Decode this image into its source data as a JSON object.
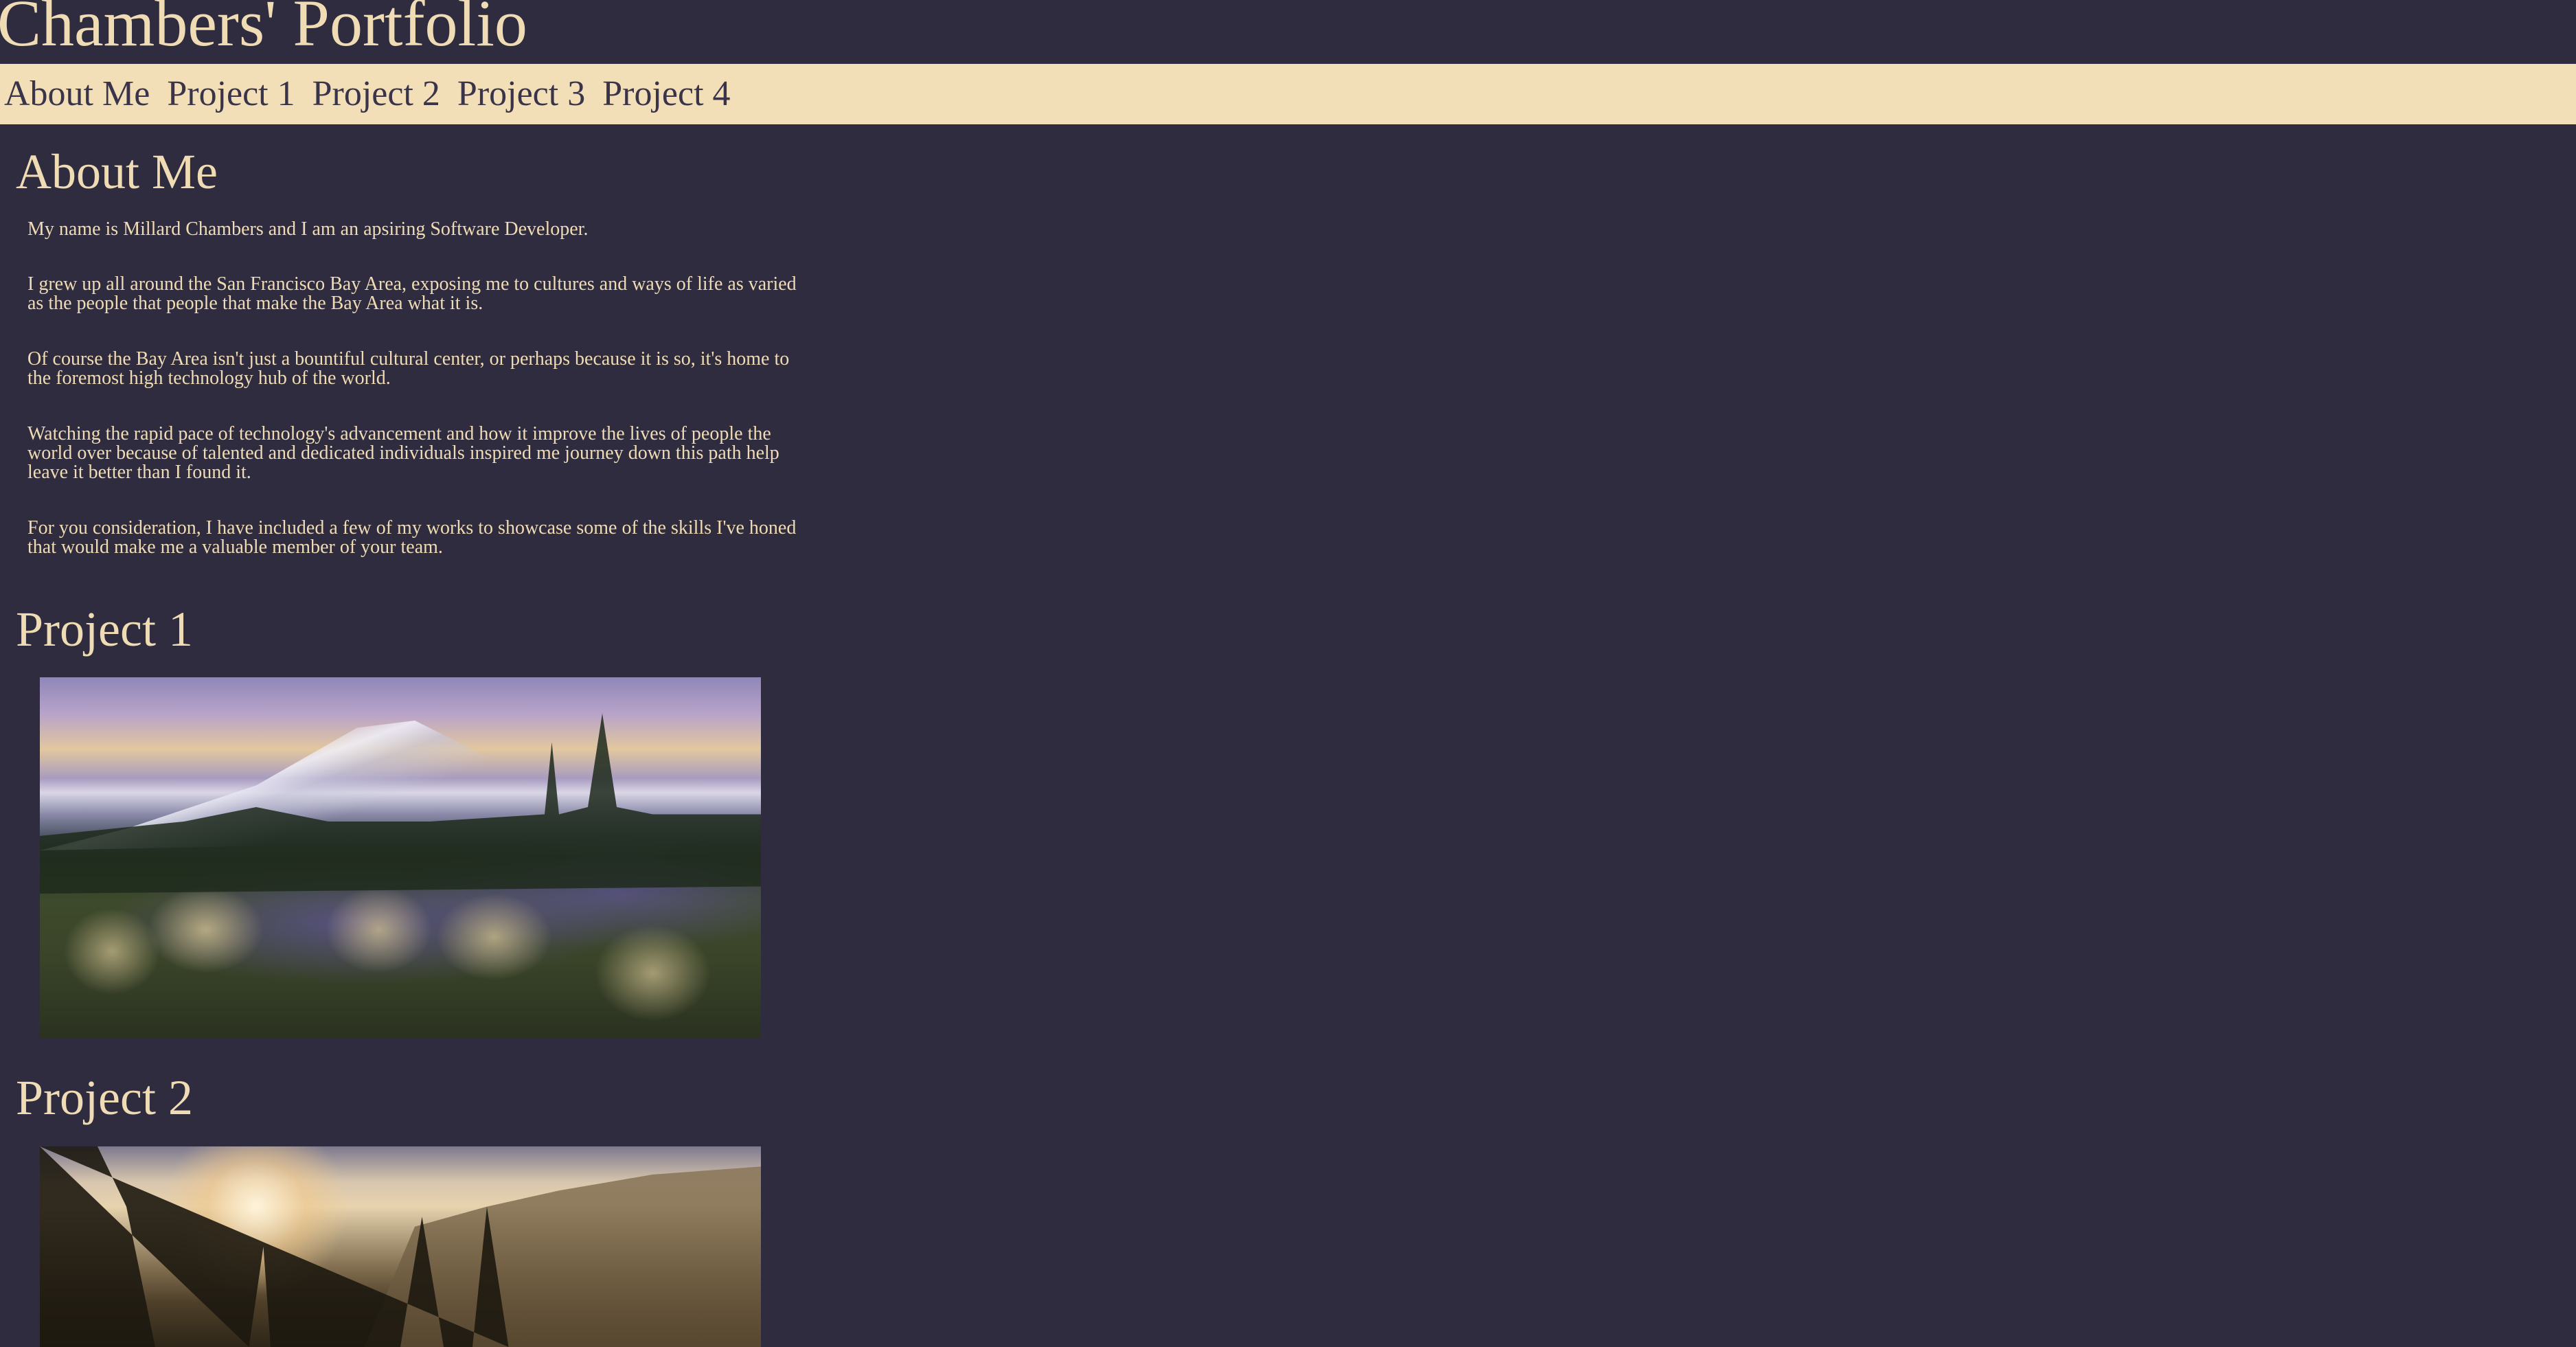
{
  "header": {
    "title": "Chambers' Portfolio"
  },
  "nav": {
    "items": [
      {
        "label": "About Me"
      },
      {
        "label": "Project 1"
      },
      {
        "label": "Project 2"
      },
      {
        "label": "Project 3"
      },
      {
        "label": "Project 4"
      }
    ]
  },
  "about": {
    "title": "About Me",
    "paragraphs": [
      "My name is Millard Chambers and I am an apsiring Software Developer.",
      "I grew up all around the San Francisco Bay Area, exposing me to cultures and ways of life as varied as the people that people that make the Bay Area what it is.",
      "Of course the Bay Area isn't just a bountiful cultural center, or perhaps because it is so, it's home to the foremost high technology hub of the world.",
      "Watching the rapid pace of technology's advancement and how it improve the lives of people the world over because of talented and dedicated individuals inspired me journey down this path help leave it better than I found it.",
      "For you consideration, I have included a few of my works to showcase some of the skills I've honed that would make me a valuable member of your team."
    ]
  },
  "projects": [
    {
      "title": "Project 1"
    },
    {
      "title": "Project 2"
    }
  ],
  "colors": {
    "background": "#2f2c3f",
    "accent": "#f2deb7",
    "text": "#f0dcb4",
    "nav_text": "#3a344a"
  }
}
